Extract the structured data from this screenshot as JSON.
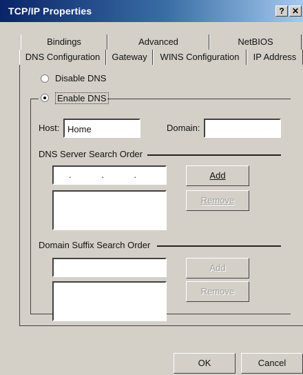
{
  "window": {
    "title": "TCP/IP Properties",
    "help_button": "?",
    "close_button": "✕"
  },
  "tabs_back": [
    "Bindings",
    "Advanced",
    "NetBIOS"
  ],
  "tabs_front": [
    "DNS Configuration",
    "Gateway",
    "WINS Configuration",
    "IP Address"
  ],
  "dns": {
    "disable_label": "Disable DNS",
    "enable_label": "Enable DNS",
    "selected": "enable"
  },
  "fields": {
    "host_label": "Host:",
    "host_value": "Home",
    "domain_label": "Domain:",
    "domain_value": ""
  },
  "server_order": {
    "label": "DNS Server Search Order",
    "ip_dots": ". . .",
    "add": "Add",
    "remove": "Remove"
  },
  "suffix_order": {
    "label": "Domain Suffix Search Order",
    "add": "Add",
    "remove": "Remove"
  },
  "footer": {
    "ok": "OK",
    "cancel": "Cancel"
  }
}
